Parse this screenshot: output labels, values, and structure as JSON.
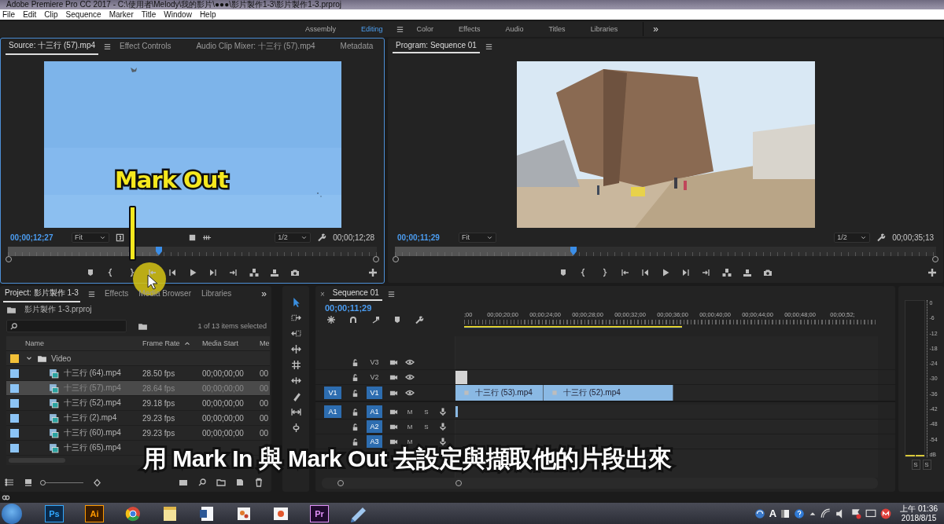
{
  "window": {
    "title": "Adobe Premiere Pro CC 2017 - C:\\使用者\\Melody\\我的影片\\●●●\\影片製作1-3\\影片製作1-3.prproj"
  },
  "menu": [
    "File",
    "Edit",
    "Clip",
    "Sequence",
    "Marker",
    "Title",
    "Window",
    "Help"
  ],
  "workspaces": [
    {
      "label": "Assembly",
      "selected": false
    },
    {
      "label": "Editing",
      "selected": true
    },
    {
      "label": "Color",
      "selected": false
    },
    {
      "label": "Effects",
      "selected": false
    },
    {
      "label": "Audio",
      "selected": false
    },
    {
      "label": "Titles",
      "selected": false
    },
    {
      "label": "Libraries",
      "selected": false
    }
  ],
  "workspace_overflow": "»",
  "source_panel": {
    "tabs": [
      {
        "label": "Source: 十三行 (57).mp4",
        "selected": true
      },
      {
        "label": "Effect Controls",
        "selected": false
      },
      {
        "label": "Audio Clip Mixer: 十三行 (57).mp4",
        "selected": false
      },
      {
        "label": "Metadata",
        "selected": false
      }
    ],
    "timecode": "00;00;12;27",
    "zoom": "Fit",
    "resolution": "1/2",
    "duration": "00;00;12;28",
    "level": 0.41
  },
  "program_panel": {
    "tab": "Program: Sequence 01",
    "timecode": "00;00;11;29",
    "zoom": "Fit",
    "resolution": "1/2",
    "duration": "00;00;35;13",
    "level": 0.33
  },
  "annotation": {
    "label": "Mark Out"
  },
  "project_panel": {
    "tabs": [
      {
        "label": "Project: 影片製作 1-3",
        "selected": true
      },
      {
        "label": "Effects",
        "selected": false
      },
      {
        "label": "Media Browser",
        "selected": false
      },
      {
        "label": "Libraries",
        "selected": false
      }
    ],
    "overflow": "»",
    "zoom_slider": {
      "level": 0.05
    },
    "file": "影片製作 1-3.prproj",
    "selection_info": "1 of 13 items selected",
    "columns": [
      "Name",
      "Frame Rate",
      "Media Start",
      "Me"
    ],
    "folder": {
      "name": "Video",
      "expanded": true,
      "color": "#f2c038"
    },
    "rows": [
      {
        "name": "十三行 (64).mp4",
        "frame_rate": "28.50 fps",
        "media_start": "00;00;00;00",
        "column_4": "00",
        "selected": false,
        "color": "#8cc4f5"
      },
      {
        "name": "十三行 (57).mp4",
        "frame_rate": "28.64 fps",
        "media_start": "00;00;00;00",
        "column_4": "00",
        "selected": true,
        "color": "#8cc4f5"
      },
      {
        "name": "十三行 (52).mp4",
        "frame_rate": "29.18 fps",
        "media_start": "00;00;00;00",
        "column_4": "00",
        "selected": false,
        "color": "#8cc4f5"
      },
      {
        "name": "十三行 (2).mp4",
        "frame_rate": "29.23 fps",
        "media_start": "00;00;00;00",
        "column_4": "00",
        "selected": false,
        "color": "#8cc4f5"
      },
      {
        "name": "十三行 (60).mp4",
        "frame_rate": "29.23 fps",
        "media_start": "00;00;00;00",
        "column_4": "00",
        "selected": false,
        "color": "#8cc4f5"
      },
      {
        "name": "十三行 (65).mp4",
        "selected": false,
        "color": "#8cc4f5"
      }
    ]
  },
  "timeline": {
    "tab": "Sequence 01",
    "close": "×",
    "timecode": "00;00;11;29",
    "ruler": [
      ";00",
      "00;00;20;00",
      "00;00;24;00",
      "00;00;28;00",
      "00;00;32;00",
      "00;00;36;00",
      "00;00;40;00",
      "00;00;44;00",
      "00;00;48;00",
      "00;00;52;"
    ],
    "tracks": [
      {
        "kind": "video",
        "label": "V3",
        "targeted": false
      },
      {
        "kind": "video",
        "label": "V2",
        "targeted": false,
        "clips": [
          {
            "kind": "title"
          }
        ]
      },
      {
        "kind": "video",
        "label": "V1",
        "source": "V1",
        "targeted": true,
        "clips": [
          {
            "kind": "video",
            "name": "十三行 (53).mp4"
          },
          {
            "kind": "video",
            "name": "十三行 (52).mp4"
          }
        ]
      },
      {
        "kind": "audio",
        "label": "A1",
        "source": "A1",
        "targeted": true,
        "mute": "M",
        "solo": "S",
        "clips": [
          {
            "kind": "audio"
          }
        ]
      },
      {
        "kind": "audio",
        "label": "A2",
        "targeted": true,
        "mute": "M",
        "solo": "S"
      },
      {
        "kind": "audio",
        "label": "A3",
        "targeted": true,
        "mute": "M"
      }
    ]
  },
  "meters": {
    "scale": [
      "0",
      "-6",
      "-12",
      "-18",
      "-24",
      "-30",
      "-36",
      "-42",
      "-48",
      "-54",
      "dB"
    ],
    "solo": [
      "S",
      "S"
    ]
  },
  "subtitle": "用 **Mark In** 與 **Mark Out** 去設定與擷取他的片段出來",
  "taskbar": {
    "apps": [
      {
        "kind": "photoshop",
        "label": "Ps"
      },
      {
        "kind": "illustrator",
        "label": "Ai"
      },
      {
        "kind": "browser"
      },
      {
        "kind": "notes"
      },
      {
        "kind": "document"
      },
      {
        "kind": "paint"
      },
      {
        "kind": "slides"
      },
      {
        "kind": "premiere",
        "label": "Pr"
      },
      {
        "kind": "files"
      }
    ],
    "ime": "A",
    "time": "上午 01:36",
    "date": "2018/8/15"
  }
}
